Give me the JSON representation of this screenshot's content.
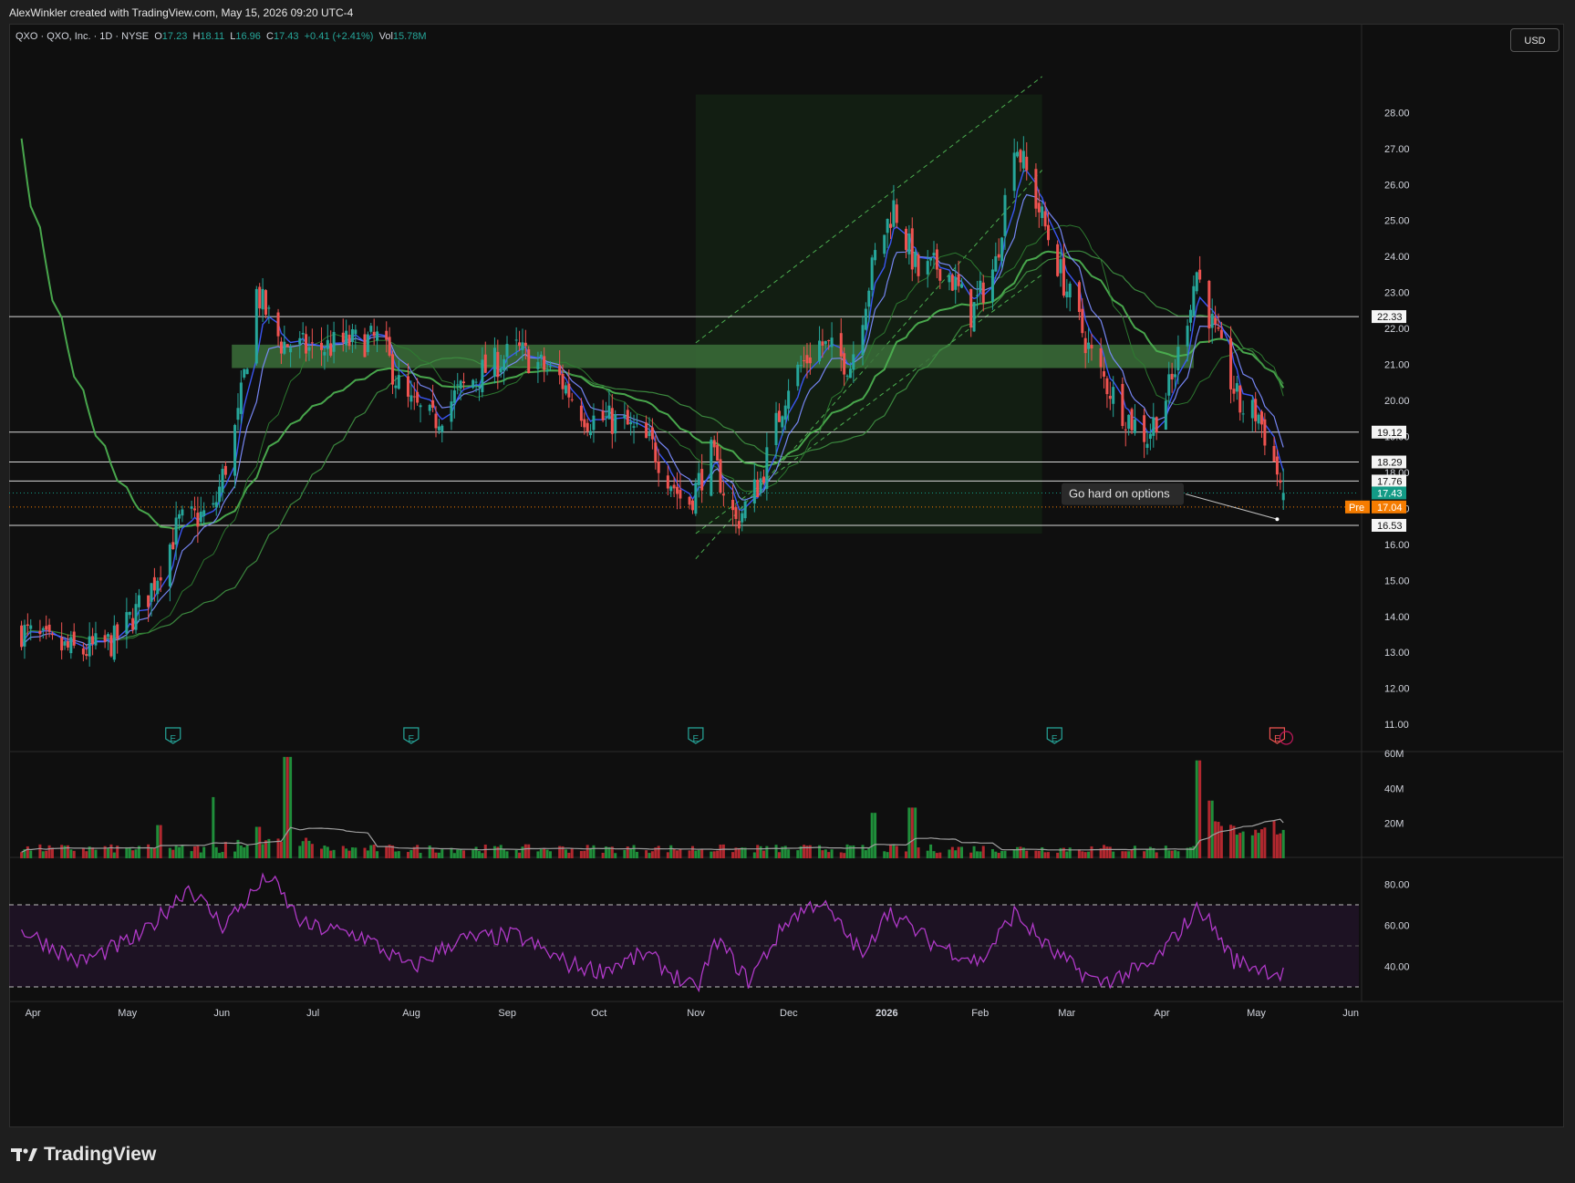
{
  "header": {
    "attribution": "AlexWinkler created with TradingView.com, May 15, 2026 09:20 UTC-4"
  },
  "legend": {
    "symbol": "QXO · QXO, Inc. · 1D · NYSE",
    "open_label": "O",
    "open": "17.23",
    "high_label": "H",
    "high": "18.11",
    "low_label": "L",
    "low": "16.96",
    "close_label": "C",
    "close": "17.43",
    "change": "+0.41 (+2.41%)",
    "volume_label": "Vol",
    "volume": "15.78M"
  },
  "currency_button": "USD",
  "brand": "TradingView",
  "colors": {
    "up": "#26a69a",
    "down": "#ef5350",
    "ma_blue": "#3d5afe",
    "ma_green": "#4caf50",
    "rsi": "#b039c8",
    "price_badge": "#139b86",
    "pre_badge": "#f57c00",
    "zone": "#3b6e39"
  },
  "chart_data": [
    {
      "type": "candlestick",
      "title": "QXO · QXO, Inc. · 1D · NYSE",
      "ylim": [
        10.7,
        29.2
      ],
      "y_ticks": [
        "11.00",
        "12.00",
        "13.00",
        "14.00",
        "15.00",
        "16.00",
        "17.00",
        "18.00",
        "19.00",
        "20.00",
        "21.00",
        "22.00",
        "23.00",
        "24.00",
        "25.00",
        "26.00",
        "27.00",
        "28.00"
      ],
      "x_ticks": [
        "Apr",
        "May",
        "Jun",
        "Jul",
        "Aug",
        "Sep",
        "Oct",
        "Nov",
        "Dec",
        "2026",
        "Feb",
        "Mar",
        "Apr",
        "May",
        "Jun"
      ],
      "close_path": [
        {
          "date": "2025-04-01",
          "close": 13.6
        },
        {
          "date": "2025-04-10",
          "close": 13.2
        },
        {
          "date": "2025-04-20",
          "close": 13.0
        },
        {
          "date": "2025-05-01",
          "close": 13.3
        },
        {
          "date": "2025-05-12",
          "close": 14.6
        },
        {
          "date": "2025-05-22",
          "close": 16.6
        },
        {
          "date": "2025-06-02",
          "close": 16.9
        },
        {
          "date": "2025-06-10",
          "close": 19.5
        },
        {
          "date": "2025-06-16",
          "close": 23.0
        },
        {
          "date": "2025-06-24",
          "close": 21.6
        },
        {
          "date": "2025-07-04",
          "close": 21.4
        },
        {
          "date": "2025-07-15",
          "close": 21.6
        },
        {
          "date": "2025-07-26",
          "close": 21.7
        },
        {
          "date": "2025-08-03",
          "close": 20.0
        },
        {
          "date": "2025-08-12",
          "close": 19.4
        },
        {
          "date": "2025-08-20",
          "close": 20.2
        },
        {
          "date": "2025-08-28",
          "close": 20.8
        },
        {
          "date": "2025-09-08",
          "close": 21.4
        },
        {
          "date": "2025-09-22",
          "close": 20.6
        },
        {
          "date": "2025-10-01",
          "close": 19.5
        },
        {
          "date": "2025-10-12",
          "close": 19.4
        },
        {
          "date": "2025-10-22",
          "close": 18.7
        },
        {
          "date": "2025-11-02",
          "close": 17.0
        },
        {
          "date": "2025-11-10",
          "close": 18.5
        },
        {
          "date": "2025-11-18",
          "close": 16.6
        },
        {
          "date": "2025-11-26",
          "close": 17.8
        },
        {
          "date": "2025-12-05",
          "close": 20.5
        },
        {
          "date": "2025-12-15",
          "close": 21.6
        },
        {
          "date": "2025-12-25",
          "close": 21.0
        },
        {
          "date": "2026-01-02",
          "close": 24.0
        },
        {
          "date": "2026-01-08",
          "close": 25.4
        },
        {
          "date": "2026-01-16",
          "close": 23.5
        },
        {
          "date": "2026-01-24",
          "close": 23.8
        },
        {
          "date": "2026-02-02",
          "close": 22.4
        },
        {
          "date": "2026-02-10",
          "close": 23.8
        },
        {
          "date": "2026-02-16",
          "close": 27.3
        },
        {
          "date": "2026-02-24",
          "close": 25.3
        },
        {
          "date": "2026-03-04",
          "close": 23.3
        },
        {
          "date": "2026-03-14",
          "close": 21.0
        },
        {
          "date": "2026-03-24",
          "close": 19.6
        },
        {
          "date": "2026-03-31",
          "close": 19.0
        },
        {
          "date": "2026-04-08",
          "close": 20.5
        },
        {
          "date": "2026-04-16",
          "close": 23.6
        },
        {
          "date": "2026-04-22",
          "close": 21.8
        },
        {
          "date": "2026-04-30",
          "close": 19.8
        },
        {
          "date": "2026-05-06",
          "close": 19.6
        },
        {
          "date": "2026-05-12",
          "close": 18.0
        },
        {
          "date": "2026-05-14",
          "close": 17.43
        }
      ],
      "current": {
        "open": 17.23,
        "high": 18.11,
        "low": 16.96,
        "close": 17.43,
        "volume": "15.78M"
      },
      "horizontal_levels": [
        22.33,
        19.12,
        18.29,
        17.76,
        16.53
      ],
      "price_badges": [
        {
          "label": "22.33",
          "value": 22.33
        },
        {
          "label": "19.12",
          "value": 19.12
        },
        {
          "label": "18.29",
          "value": 18.29
        },
        {
          "label": "17.76",
          "value": 17.76
        },
        {
          "label": "17.43",
          "value": 17.43,
          "kind": "last"
        },
        {
          "label": "17.04",
          "value": 17.04,
          "kind": "pre",
          "prefix": "Pre"
        },
        {
          "label": "16.53",
          "value": 16.53
        }
      ],
      "zone": {
        "from": "2025-06-08",
        "to": "2026-04-15",
        "low": 20.9,
        "high": 21.55
      },
      "annotation": {
        "text": "Go hard on options",
        "date": "2026-05-12",
        "value": 16.7
      },
      "earnings_markers": [
        {
          "date": "2025-05-20",
          "label": "E"
        },
        {
          "date": "2025-08-05",
          "label": "E"
        },
        {
          "date": "2025-11-05",
          "label": "E"
        },
        {
          "date": "2026-03-01",
          "label": "E"
        },
        {
          "date": "2026-05-12",
          "label": "E"
        }
      ]
    },
    {
      "type": "bar",
      "title": "Volume",
      "y_ticks": [
        "20M",
        "40M",
        "60M"
      ],
      "ylim": [
        0,
        60
      ],
      "spikes": [
        {
          "date": "2025-05-16",
          "value": 19
        },
        {
          "date": "2025-06-01",
          "value": 35
        },
        {
          "date": "2025-06-16",
          "value": 18
        },
        {
          "date": "2025-06-26",
          "value": 58
        },
        {
          "date": "2026-01-02",
          "value": 26
        },
        {
          "date": "2026-01-14",
          "value": 29
        },
        {
          "date": "2026-04-17",
          "value": 56
        },
        {
          "date": "2026-04-20",
          "value": 33
        }
      ]
    },
    {
      "type": "line",
      "title": "RSI",
      "ylim": [
        26,
        86
      ],
      "y_ticks": [
        "40.00",
        "60.00",
        "80.00"
      ],
      "bands": [
        30,
        50,
        70
      ],
      "points": [
        {
          "date": "2025-04-01",
          "value": 58
        },
        {
          "date": "2025-04-20",
          "value": 42
        },
        {
          "date": "2025-05-10",
          "value": 55
        },
        {
          "date": "2025-05-25",
          "value": 79
        },
        {
          "date": "2025-06-05",
          "value": 60
        },
        {
          "date": "2025-06-20",
          "value": 84
        },
        {
          "date": "2025-07-01",
          "value": 60
        },
        {
          "date": "2025-07-20",
          "value": 55
        },
        {
          "date": "2025-08-05",
          "value": 39
        },
        {
          "date": "2025-08-20",
          "value": 53
        },
        {
          "date": "2025-09-08",
          "value": 55
        },
        {
          "date": "2025-09-25",
          "value": 41
        },
        {
          "date": "2025-10-05",
          "value": 38
        },
        {
          "date": "2025-10-20",
          "value": 46
        },
        {
          "date": "2025-11-05",
          "value": 28
        },
        {
          "date": "2025-11-12",
          "value": 53
        },
        {
          "date": "2025-11-22",
          "value": 33
        },
        {
          "date": "2025-12-05",
          "value": 63
        },
        {
          "date": "2025-12-15",
          "value": 72
        },
        {
          "date": "2025-12-30",
          "value": 44
        },
        {
          "date": "2026-01-05",
          "value": 68
        },
        {
          "date": "2026-01-20",
          "value": 52
        },
        {
          "date": "2026-02-05",
          "value": 42
        },
        {
          "date": "2026-02-16",
          "value": 66
        },
        {
          "date": "2026-03-01",
          "value": 46
        },
        {
          "date": "2026-03-15",
          "value": 32
        },
        {
          "date": "2026-04-01",
          "value": 40
        },
        {
          "date": "2026-04-17",
          "value": 69
        },
        {
          "date": "2026-04-28",
          "value": 43
        },
        {
          "date": "2026-05-14",
          "value": 36
        }
      ]
    }
  ]
}
